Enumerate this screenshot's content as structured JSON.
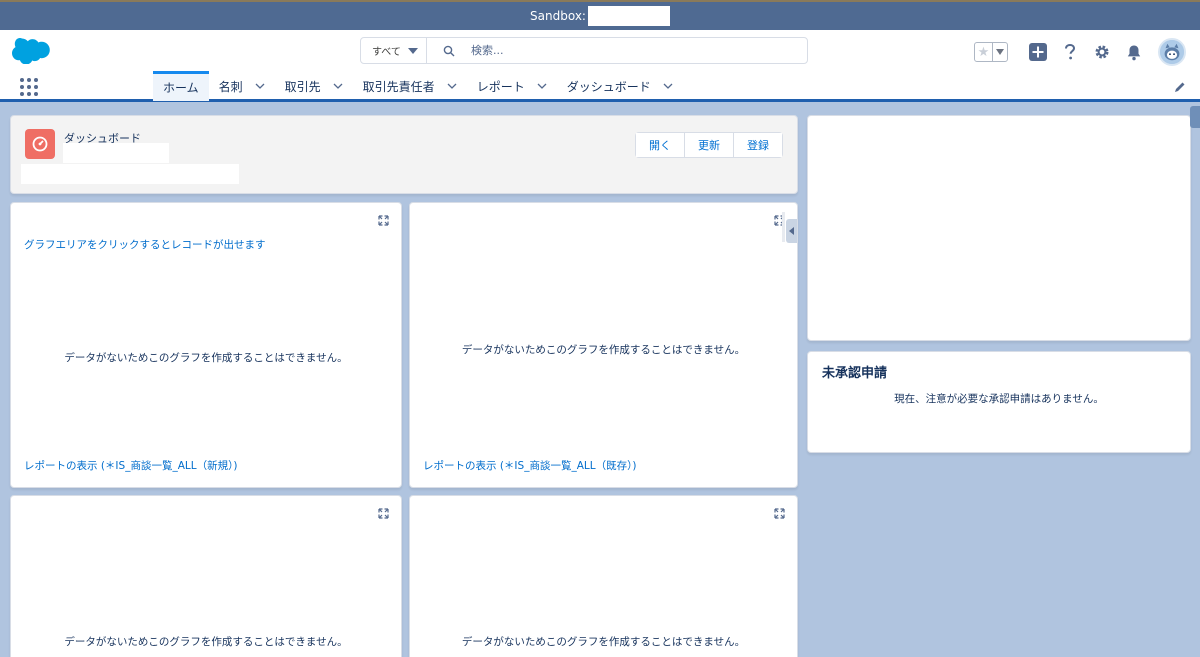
{
  "sandbox": {
    "label": "Sandbox:"
  },
  "search": {
    "scope_label": "すべて",
    "placeholder": "検索..."
  },
  "nav": {
    "tabs": [
      {
        "label": "ホーム",
        "active": true
      },
      {
        "label": "名刺"
      },
      {
        "label": "取引先"
      },
      {
        "label": "取引先責任者"
      },
      {
        "label": "レポート"
      },
      {
        "label": "ダッシュボード"
      }
    ]
  },
  "dashboard": {
    "type_label": "ダッシュボード",
    "buttons": {
      "open": "開く",
      "refresh": "更新",
      "subscribe": "登録"
    }
  },
  "charts": {
    "c1": {
      "hint": "グラフエリアをクリックするとレコードが出せます",
      "nodata": "データがないためこのグラフを作成することはできません。",
      "link": "レポートの表示 (＊IS_商談一覧_ALL（新規）)"
    },
    "c2": {
      "nodata": "データがないためこのグラフを作成することはできません。",
      "link": "レポートの表示 (＊IS_商談一覧_ALL（既存）)"
    },
    "c3": {
      "nodata": "データがないためこのグラフを作成することはできません。"
    },
    "c4": {
      "nodata": "データがないためこのグラフを作成することはできません。"
    }
  },
  "approvals": {
    "title": "未承認申請",
    "message": "現在、注意が必要な承認申請はありません。"
  },
  "colors": {
    "brand": "#1589ee",
    "header_bar": "#4f6a92",
    "dashboard_icon": "#ef6e64",
    "link": "#006dcc",
    "background": "#b0c4df"
  }
}
